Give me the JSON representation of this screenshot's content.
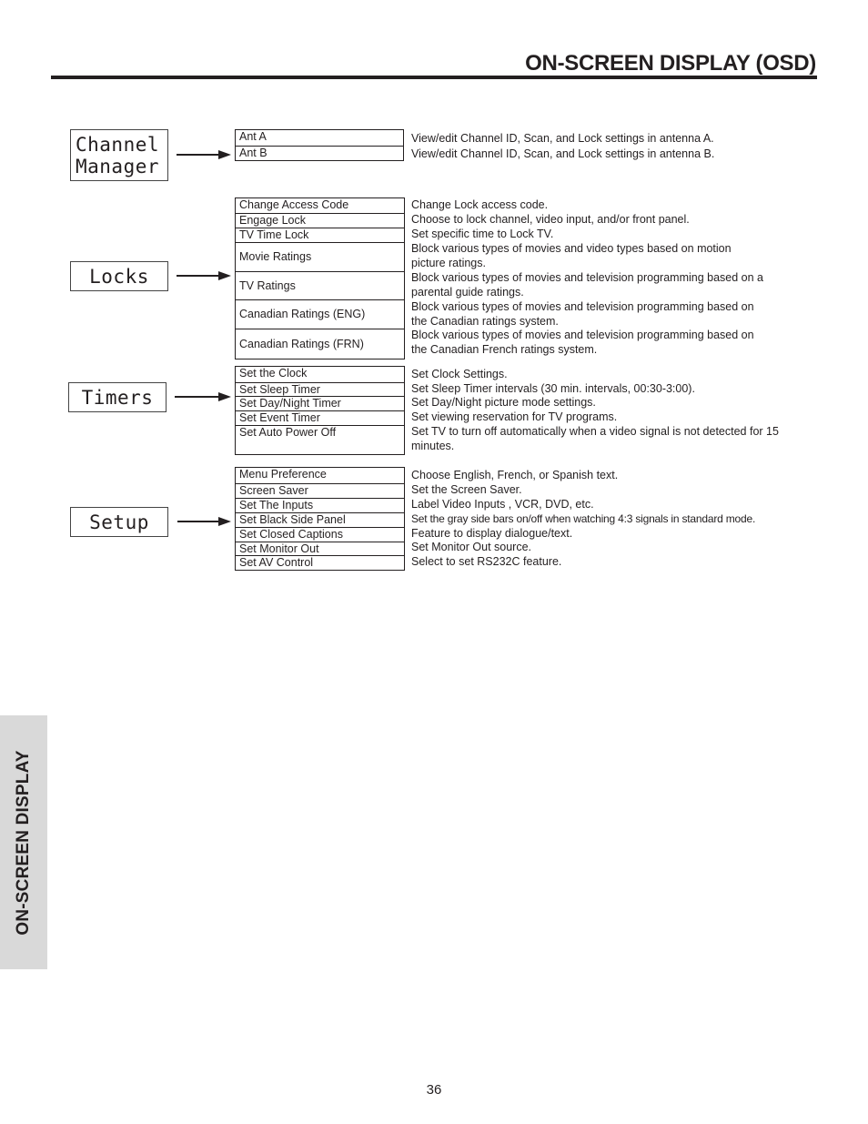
{
  "header": {
    "title": "ON-SCREEN DISPLAY (OSD)"
  },
  "side_tab": {
    "label": "ON-SCREEN DISPLAY"
  },
  "page_number": "36",
  "sections": [
    {
      "menu_lines": [
        "Channel",
        "Manager"
      ],
      "items": [
        {
          "label": "Ant A",
          "description": "View/edit Channel ID, Scan, and Lock settings in antenna A."
        },
        {
          "label": "Ant B",
          "description": "View/edit Channel ID, Scan, and Lock settings in antenna B."
        }
      ]
    },
    {
      "menu_lines": [
        "Locks"
      ],
      "items": [
        {
          "label": "Change Access Code",
          "description": "Change Lock access code."
        },
        {
          "label": "Engage Lock",
          "description": "Choose to lock channel, video input, and/or front panel."
        },
        {
          "label": "TV Time Lock",
          "description": "Set specific time to Lock TV."
        },
        {
          "label": "Movie Ratings",
          "description": "Block various types of movies and video types based on motion picture ratings.",
          "desc_lines": [
            "Block various types of movies and video types based on motion",
            "picture ratings."
          ]
        },
        {
          "label": "TV Ratings",
          "description": "Block various types of movies and television programming based on a parental guide ratings.",
          "desc_lines": [
            "Block various types of movies and television programming based on a",
            "parental guide ratings."
          ]
        },
        {
          "label": "Canadian Ratings (ENG)",
          "description": "Block various types of movies and television programming based on the Canadian ratings system.",
          "desc_lines": [
            "Block various types of movies and television programming based on",
            "the Canadian ratings system."
          ]
        },
        {
          "label": "Canadian Ratings (FRN)",
          "description": "Block various types of movies and television programming based on the Canadian French ratings system.",
          "desc_lines": [
            "Block various types of movies and television programming based on",
            "the Canadian French ratings system."
          ]
        }
      ]
    },
    {
      "menu_lines": [
        "Timers"
      ],
      "items": [
        {
          "label": "Set the Clock",
          "description": "Set Clock Settings."
        },
        {
          "label": "Set Sleep Timer",
          "description": "Set Sleep Timer intervals (30 min. intervals, 00:30-3:00)."
        },
        {
          "label": "Set Day/Night Timer",
          "description": "Set Day/Night picture mode settings."
        },
        {
          "label": "Set Event Timer",
          "description": "Set viewing reservation for TV programs."
        },
        {
          "label": "Set Auto Power Off",
          "description": "Set TV to turn off automatically when a video signal is not detected for 15 minutes.",
          "desc_lines": [
            "Set TV to turn off automatically when a video signal is not detected for 15",
            "minutes."
          ]
        }
      ]
    },
    {
      "menu_lines": [
        "Setup"
      ],
      "items": [
        {
          "label": "Menu Preference",
          "description": "Choose English, French, or Spanish text."
        },
        {
          "label": "Screen Saver",
          "description": "Set the Screen Saver."
        },
        {
          "label": "Set The Inputs",
          "description": "Label Video Inputs , VCR, DVD, etc."
        },
        {
          "label": "Set Black Side Panel",
          "description": "Set the gray side bars on/off when watching 4:3 signals in standard mode."
        },
        {
          "label": "Set Closed Captions",
          "description": "Feature to display dialogue/text."
        },
        {
          "label": "Set Monitor Out",
          "description": "Set Monitor Out source."
        },
        {
          "label": "Set AV Control",
          "description": "Select to set RS232C feature."
        }
      ]
    }
  ]
}
